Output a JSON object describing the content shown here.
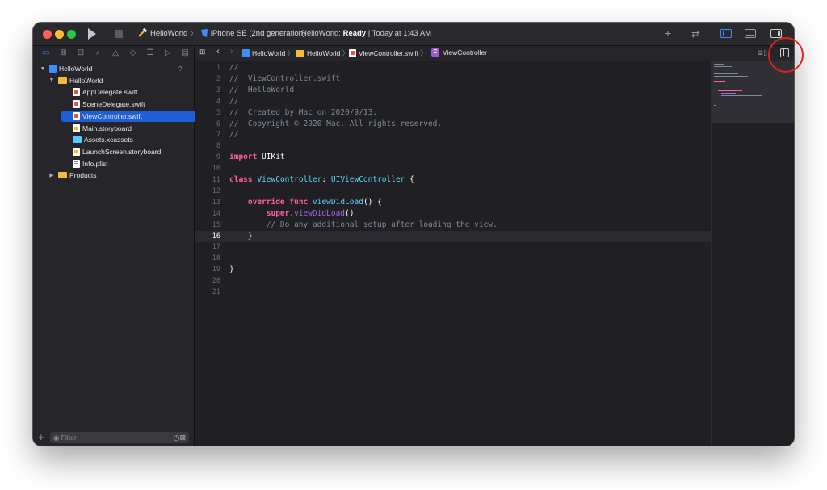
{
  "toolbar": {
    "scheme": "HelloWorld",
    "separator": "〉",
    "device": "iPhone SE (2nd generation)",
    "status_project": "HelloWorld:",
    "status_state": "Ready",
    "status_time": "| Today at 1:43 AM"
  },
  "navigator": {
    "tree": [
      {
        "label": "HelloWorld",
        "icon": "project-icon",
        "level": 0,
        "expanded": true,
        "badge": "?"
      },
      {
        "label": "HelloWorld",
        "icon": "folder-icon",
        "level": 1,
        "expanded": true
      },
      {
        "label": "AppDelegate.swift",
        "icon": "swift-file-icon",
        "level": 2
      },
      {
        "label": "SceneDelegate.swift",
        "icon": "swift-file-icon",
        "level": 2
      },
      {
        "label": "ViewController.swift",
        "icon": "swift-file-icon",
        "level": 2,
        "selected": true
      },
      {
        "label": "Main.storyboard",
        "icon": "storyboard-icon",
        "level": 2
      },
      {
        "label": "Assets.xcassets",
        "icon": "assets-icon",
        "level": 2
      },
      {
        "label": "LaunchScreen.storyboard",
        "icon": "storyboard-icon",
        "level": 2
      },
      {
        "label": "Info.plist",
        "icon": "plist-icon",
        "level": 2
      },
      {
        "label": "Products",
        "icon": "folder-icon",
        "level": 1,
        "expanded": false
      }
    ],
    "filter_placeholder": "Filter"
  },
  "jumpbar": {
    "crumbs": [
      "HelloWorld",
      "HelloWorld",
      "ViewController.swift",
      "ViewController"
    ],
    "class_badge": "C"
  },
  "editor": {
    "current_line": 16,
    "lines": [
      [
        [
          "c",
          "//"
        ]
      ],
      [
        [
          "c",
          "//  ViewController.swift"
        ]
      ],
      [
        [
          "c",
          "//  HelloWorld"
        ]
      ],
      [
        [
          "c",
          "//"
        ]
      ],
      [
        [
          "c",
          "//  Created by Mac on 2020/9/13."
        ]
      ],
      [
        [
          "c",
          "//  Copyright © 2020 Mac. All rights reserved."
        ]
      ],
      [
        [
          "c",
          "//"
        ]
      ],
      [],
      [
        [
          "k",
          "import"
        ],
        [
          "p",
          " UIKit"
        ]
      ],
      [],
      [
        [
          "k",
          "class"
        ],
        [
          "p",
          " "
        ],
        [
          "t",
          "ViewController"
        ],
        [
          "p",
          ": "
        ],
        [
          "t",
          "UIViewController"
        ],
        [
          "p",
          " {"
        ]
      ],
      [],
      [
        [
          "p",
          "    "
        ],
        [
          "k",
          "override"
        ],
        [
          "p",
          " "
        ],
        [
          "k",
          "func"
        ],
        [
          "p",
          " "
        ],
        [
          "t",
          "viewDidLoad"
        ],
        [
          "p",
          "() {"
        ]
      ],
      [
        [
          "p",
          "        "
        ],
        [
          "k",
          "super"
        ],
        [
          "p",
          "."
        ],
        [
          "f",
          "viewDidLoad"
        ],
        [
          "p",
          "()"
        ]
      ],
      [
        [
          "p",
          "        "
        ],
        [
          "c",
          "// Do any additional setup after loading the view."
        ]
      ],
      [
        [
          "p",
          "    }"
        ]
      ],
      [],
      [],
      [
        [
          "p",
          "}"
        ]
      ],
      [],
      []
    ]
  },
  "colors": {
    "accent": "#1d5fd6",
    "keyword": "#fc5fa3",
    "type": "#5dd8ff",
    "comment": "#7f8c98",
    "annotation_circle": "#e2231a"
  }
}
